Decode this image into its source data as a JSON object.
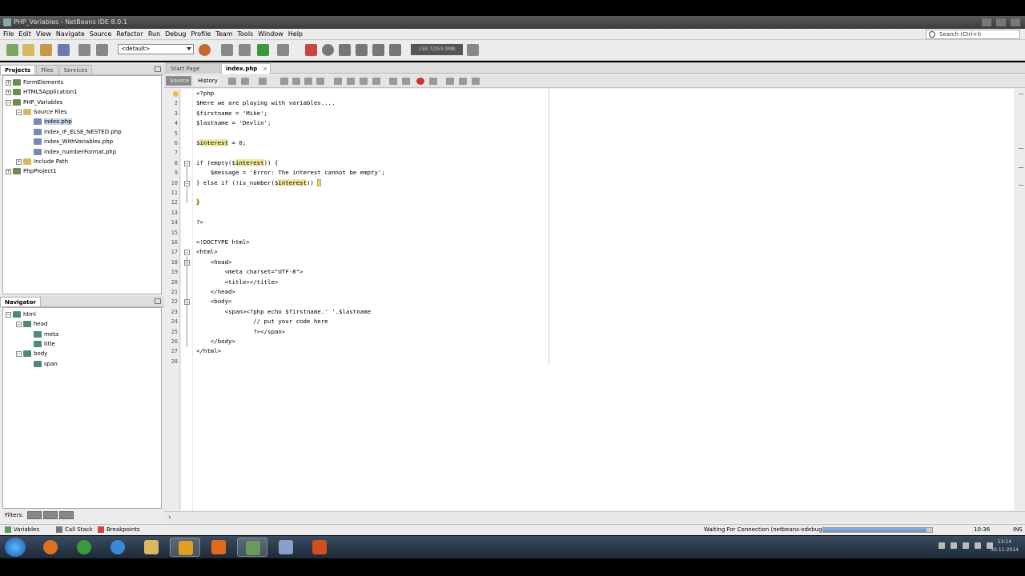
{
  "window": {
    "title": "PHP_Variables - NetBeans IDE 8.0.1"
  },
  "menu": [
    "File",
    "Edit",
    "View",
    "Navigate",
    "Source",
    "Refactor",
    "Run",
    "Debug",
    "Profile",
    "Team",
    "Tools",
    "Window",
    "Help"
  ],
  "search": {
    "placeholder": "Search (Ctrl+I)"
  },
  "toolbar": {
    "config": "<default>",
    "memory": "159.7/253.0MB"
  },
  "projects_panel": {
    "tabs": [
      "Projects",
      "Files",
      "Services"
    ],
    "nodes": [
      "FormElements",
      "HTML5Application1",
      "PHP_Variables",
      "Source Files",
      "index.php",
      "index_IF_ELSE_NESTED.php",
      "index_WithVariables.php",
      "index_numberFormat.php",
      "Include Path",
      "PhpProject1"
    ]
  },
  "navigator_panel": {
    "title": "Navigator",
    "nodes": [
      "html",
      "head",
      "meta",
      "title",
      "body",
      "span"
    ]
  },
  "filters": {
    "label": "Filters:"
  },
  "editor": {
    "tabs": [
      "Start Page",
      "index.php"
    ],
    "source_label": "Source",
    "history_label": "History",
    "line_numbers": [
      "1",
      "2",
      "3",
      "4",
      "5",
      "6",
      "7",
      "8",
      "9",
      "10",
      "11",
      "12",
      "13",
      "14",
      "15",
      "16",
      "17",
      "18",
      "19",
      "20",
      "21",
      "22",
      "23",
      "24",
      "25",
      "26",
      "27",
      "28"
    ],
    "lines": {
      "l1": "<?php",
      "l2": "$Here we are playing with variables....",
      "l3": "$firstname = 'Mike';",
      "l4": "$lastname = 'Devlin';",
      "l6a": "$",
      "l6b": "interest",
      "l6c": " = 0;",
      "l8a": "if (empty($",
      "l8b": "interest",
      "l8c": ")) {",
      "l9": "    $message = 'Error: The interest cannot be empty';",
      "l10a": "} else if (!is_number($",
      "l10b": "interest",
      "l10c": ")) ",
      "l12": "}",
      "l14": "?>",
      "l16": "<!DOCTYPE html>",
      "l17": "<html>",
      "l18": "    <head>",
      "l19": "        <meta charset=\"UTF-8\">",
      "l20": "        <title></title>",
      "l21": "    </head>",
      "l22": "    <body>",
      "l23": "        <span><?php echo $firstname.' '.$lastname",
      "l24": "                // put your code here",
      "l25": "                ?></span>",
      "l26": "    </body>",
      "l27": "</html>"
    }
  },
  "bottom_bar": {
    "tabs": [
      "Variables",
      "Call Stack",
      "Breakpoints"
    ],
    "status": "Waiting For Connection (netbeans-xdebug)",
    "progress": 0.95,
    "cursor_pos": "10:36",
    "mode": "INS"
  },
  "clock": {
    "time": "13:14",
    "date": "30-11-2014"
  }
}
